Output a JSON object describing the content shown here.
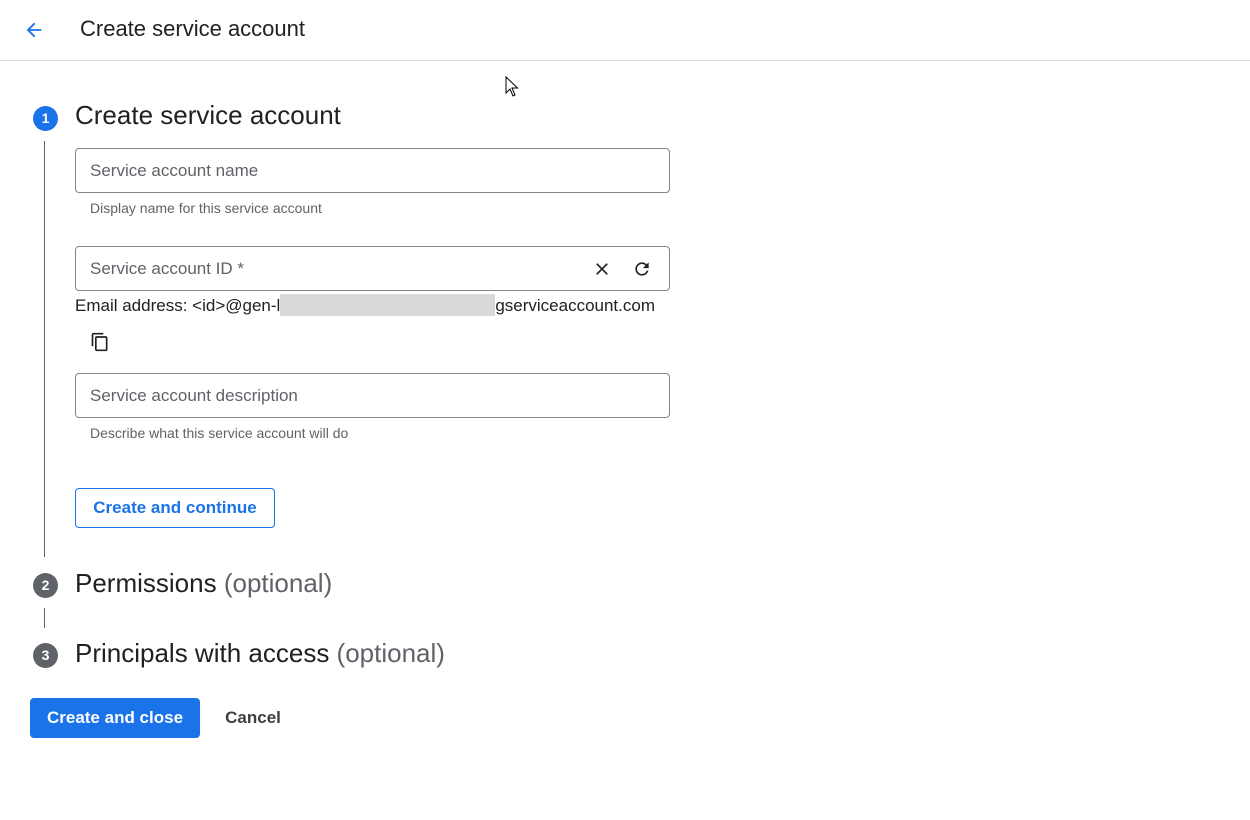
{
  "header": {
    "back_icon": "arrow-back-icon",
    "title": "Create service account"
  },
  "colors": {
    "accent": "#1a73e8",
    "step_inactive": "#5f6368",
    "divider": "#dadce0"
  },
  "steps": [
    {
      "number": "1",
      "title": "Create service account",
      "suffix": "",
      "active": true
    },
    {
      "number": "2",
      "title": "Permissions",
      "suffix": "(optional)",
      "active": false
    },
    {
      "number": "3",
      "title": "Principals with access",
      "suffix": "(optional)",
      "active": false
    }
  ],
  "form": {
    "name_field": {
      "placeholder": "Service account name",
      "value": "",
      "hint": "Display name for this service account"
    },
    "id_field": {
      "placeholder": "Service account ID *",
      "value": "",
      "clear_icon": "close-icon",
      "regenerate_icon": "refresh-icon"
    },
    "email": {
      "prefix": "Email address: <id>@gen-l",
      "suffix": "gserviceaccount.com",
      "copy_icon": "copy-icon"
    },
    "description_field": {
      "placeholder": "Service account description",
      "value": "",
      "hint": "Describe what this service account will do"
    },
    "continue_label": "Create and continue"
  },
  "footer": {
    "create_close_label": "Create and close",
    "cancel_label": "Cancel"
  }
}
